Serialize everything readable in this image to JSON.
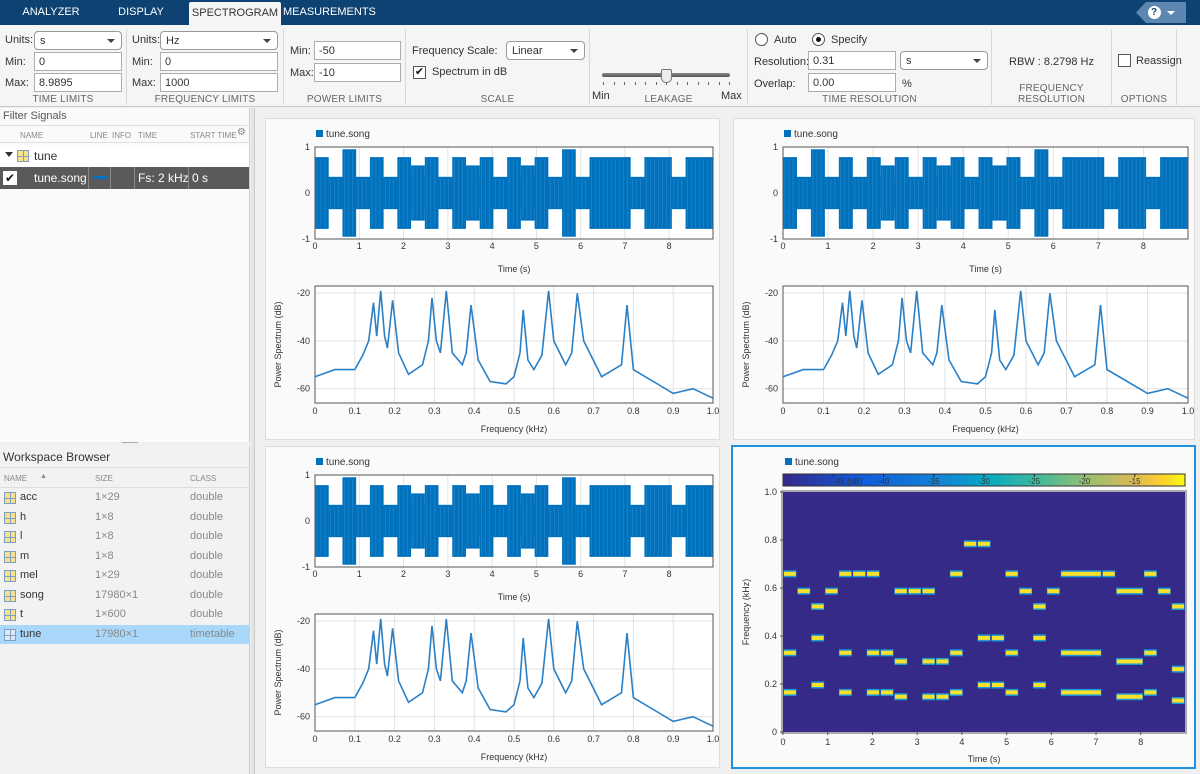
{
  "tabs": [
    {
      "label": "ANALYZER",
      "active": false
    },
    {
      "label": "DISPLAY",
      "active": false
    },
    {
      "label": "SPECTROGRAM",
      "active": true
    },
    {
      "label": "MEASUREMENTS",
      "active": false
    }
  ],
  "help": {
    "label": "?"
  },
  "ribbon": {
    "time_limits": {
      "title": "TIME LIMITS",
      "units_label": "Units:",
      "units_value": "s",
      "min_label": "Min:",
      "min_value": "0",
      "max_label": "Max:",
      "max_value": "8.9895"
    },
    "frequency_limits": {
      "title": "FREQUENCY LIMITS",
      "units_label": "Units:",
      "units_value": "Hz",
      "min_label": "Min:",
      "min_value": "0",
      "max_label": "Max:",
      "max_value": "1000"
    },
    "power_limits": {
      "title": "POWER LIMITS",
      "min_label": "Min:",
      "min_value": "-50",
      "max_label": "Max:",
      "max_value": "-10"
    },
    "scale": {
      "title": "SCALE",
      "freq_scale_label": "Frequency Scale:",
      "freq_scale_value": "Linear",
      "spectrum_db_label": "Spectrum in dB",
      "spectrum_db_checked": true
    },
    "leakage": {
      "title": "LEAKAGE",
      "min_label": "Min",
      "max_label": "Max",
      "value_fraction": 0.5
    },
    "time_resolution": {
      "title": "TIME RESOLUTION",
      "auto_label": "Auto",
      "specify_label": "Specify",
      "selected": "Specify",
      "resolution_label": "Resolution:",
      "resolution_value": "0.31",
      "resolution_units": "s",
      "overlap_label": "Overlap:",
      "overlap_value": "0.00",
      "overlap_units": "%"
    },
    "frequency_resolution": {
      "title": "FREQUENCY RESOLUTION",
      "rbw_text": "RBW : 8.2798 Hz"
    },
    "options": {
      "title": "OPTIONS",
      "reassign_label": "Reassign",
      "reassign_checked": false
    }
  },
  "filter_signals": {
    "title": "Filter Signals",
    "columns": [
      "NAME",
      "LINE",
      "INFO",
      "TIME",
      "START TIME"
    ],
    "group": {
      "name": "tune"
    },
    "rows": [
      {
        "name": "tune.song",
        "checked": true,
        "line_color": "#0072bd",
        "info": "",
        "time": "Fs: 2 kHz",
        "start_time": "0 s"
      }
    ]
  },
  "workspace": {
    "title": "Workspace Browser",
    "columns": [
      "NAME",
      "SIZE",
      "CLASS"
    ],
    "rows": [
      {
        "name": "acc",
        "size": "1×29",
        "class": "double",
        "selected": false
      },
      {
        "name": "h",
        "size": "1×8",
        "class": "double",
        "selected": false
      },
      {
        "name": "l",
        "size": "1×8",
        "class": "double",
        "selected": false
      },
      {
        "name": "m",
        "size": "1×8",
        "class": "double",
        "selected": false
      },
      {
        "name": "mel",
        "size": "1×29",
        "class": "double",
        "selected": false
      },
      {
        "name": "song",
        "size": "17980×1",
        "class": "double",
        "selected": false
      },
      {
        "name": "t",
        "size": "1×600",
        "class": "double",
        "selected": false
      },
      {
        "name": "tune",
        "size": "17980×1",
        "class": "timetable",
        "selected": true
      }
    ]
  },
  "colors": {
    "signal": "#0072bd",
    "selection": "#1e90e0",
    "tabbar": "#0e4272",
    "spec_bg": "#352a87",
    "spec_note": "#f9e02a"
  },
  "chart_data": [
    {
      "type": "line",
      "id": "time-domain",
      "legend": "tune.song",
      "xlabel": "Time (s)",
      "ylabel": "",
      "xlim": [
        0,
        8.9895
      ],
      "ylim": [
        -1,
        1
      ],
      "xticks": [
        0,
        1,
        2,
        3,
        4,
        5,
        6,
        7,
        8
      ],
      "yticks": [
        -1,
        0,
        1
      ],
      "segments": [
        {
          "t0": 0,
          "t1": 0.31,
          "amp": 0.78
        },
        {
          "t0": 0.31,
          "t1": 0.62,
          "amp": 0.35
        },
        {
          "t0": 0.62,
          "t1": 0.93,
          "amp": 0.95
        },
        {
          "t0": 0.93,
          "t1": 1.24,
          "amp": 0.35
        },
        {
          "t0": 1.24,
          "t1": 1.55,
          "amp": 0.78
        },
        {
          "t0": 1.55,
          "t1": 1.86,
          "amp": 0.35
        },
        {
          "t0": 1.86,
          "t1": 2.17,
          "amp": 0.78
        },
        {
          "t0": 2.17,
          "t1": 2.48,
          "amp": 0.6
        },
        {
          "t0": 2.48,
          "t1": 2.79,
          "amp": 0.78
        },
        {
          "t0": 2.79,
          "t1": 3.1,
          "amp": 0.35
        },
        {
          "t0": 3.1,
          "t1": 3.41,
          "amp": 0.78
        },
        {
          "t0": 3.41,
          "t1": 3.72,
          "amp": 0.6
        },
        {
          "t0": 3.72,
          "t1": 4.03,
          "amp": 0.78
        },
        {
          "t0": 4.03,
          "t1": 4.34,
          "amp": 0.35
        },
        {
          "t0": 4.34,
          "t1": 4.65,
          "amp": 0.78
        },
        {
          "t0": 4.65,
          "t1": 4.96,
          "amp": 0.6
        },
        {
          "t0": 4.96,
          "t1": 5.27,
          "amp": 0.78
        },
        {
          "t0": 5.27,
          "t1": 5.58,
          "amp": 0.35
        },
        {
          "t0": 5.58,
          "t1": 5.89,
          "amp": 0.95
        },
        {
          "t0": 5.89,
          "t1": 6.2,
          "amp": 0.35
        },
        {
          "t0": 6.2,
          "t1": 7.13,
          "amp": 0.78
        },
        {
          "t0": 7.13,
          "t1": 7.44,
          "amp": 0.35
        },
        {
          "t0": 7.44,
          "t1": 8.06,
          "amp": 0.78
        },
        {
          "t0": 8.06,
          "t1": 8.37,
          "amp": 0.35
        },
        {
          "t0": 8.37,
          "t1": 8.9895,
          "amp": 0.78
        }
      ]
    },
    {
      "type": "line",
      "id": "power-spectrum",
      "legend": "",
      "xlabel": "Frequency (kHz)",
      "ylabel": "Power Spectrum (dB)",
      "xlim": [
        0,
        1.0
      ],
      "ylim": [
        -66,
        -17
      ],
      "xticks": [
        0,
        0.1,
        0.2,
        0.3,
        0.4,
        0.5,
        0.6,
        0.7,
        0.8,
        0.9,
        1.0
      ],
      "yticks": [
        -60,
        -40,
        -20
      ],
      "x": [
        0,
        0.05,
        0.1,
        0.12,
        0.135,
        0.147,
        0.155,
        0.165,
        0.175,
        0.182,
        0.195,
        0.21,
        0.235,
        0.27,
        0.285,
        0.294,
        0.305,
        0.315,
        0.33,
        0.345,
        0.37,
        0.38,
        0.392,
        0.41,
        0.44,
        0.48,
        0.5,
        0.515,
        0.523,
        0.535,
        0.55,
        0.57,
        0.587,
        0.6,
        0.63,
        0.645,
        0.659,
        0.675,
        0.72,
        0.77,
        0.784,
        0.8,
        0.85,
        0.9,
        0.95,
        1.0
      ],
      "y": [
        -55,
        -52,
        -52,
        -46,
        -40,
        -24,
        -38,
        -19,
        -38,
        -43,
        -23,
        -45,
        -54,
        -50,
        -40,
        -22,
        -40,
        -45,
        -19,
        -45,
        -50,
        -45,
        -25,
        -48,
        -57,
        -58,
        -55,
        -45,
        -27,
        -48,
        -52,
        -46,
        -19,
        -40,
        -50,
        -45,
        -20,
        -40,
        -55,
        -50,
        -25,
        -52,
        -57,
        -62,
        -60,
        -64
      ]
    },
    {
      "type": "heatmap",
      "id": "spectrogram",
      "legend": "tune.song",
      "xlabel": "Time (s)",
      "ylabel": "Frequency (kHz)",
      "xlim": [
        0,
        8.9895
      ],
      "ylim": [
        0,
        1.0
      ],
      "xticks": [
        0,
        1,
        2,
        3,
        4,
        5,
        6,
        7,
        8
      ],
      "yticks": [
        0,
        0.2,
        0.4,
        0.6,
        0.8,
        1.0
      ],
      "colorbar": {
        "label": "(dB)",
        "ticks": [
          -45,
          -40,
          -35,
          -30,
          -25,
          -20,
          -15
        ],
        "range": [
          -50,
          -10
        ]
      },
      "notes": [
        {
          "t0": 0,
          "t1": 0.31,
          "f": [
            0.165,
            0.33,
            0.659
          ]
        },
        {
          "t0": 0.31,
          "t1": 0.62,
          "f": [
            0.587
          ]
        },
        {
          "t0": 0.62,
          "t1": 0.93,
          "f": [
            0.196,
            0.392,
            0.523
          ]
        },
        {
          "t0": 0.93,
          "t1": 1.24,
          "f": [
            0.587
          ]
        },
        {
          "t0": 1.24,
          "t1": 1.55,
          "f": [
            0.165,
            0.33,
            0.659
          ]
        },
        {
          "t0": 1.55,
          "t1": 1.86,
          "f": [
            0.659
          ]
        },
        {
          "t0": 1.86,
          "t1": 2.17,
          "f": [
            0.165,
            0.33,
            0.659
          ]
        },
        {
          "t0": 2.17,
          "t1": 2.48,
          "f": [
            0.165,
            0.33
          ]
        },
        {
          "t0": 2.48,
          "t1": 2.79,
          "f": [
            0.147,
            0.294,
            0.587
          ]
        },
        {
          "t0": 2.79,
          "t1": 3.1,
          "f": [
            0.587
          ]
        },
        {
          "t0": 3.1,
          "t1": 3.41,
          "f": [
            0.147,
            0.294,
            0.587
          ]
        },
        {
          "t0": 3.41,
          "t1": 3.72,
          "f": [
            0.147,
            0.294
          ]
        },
        {
          "t0": 3.72,
          "t1": 4.03,
          "f": [
            0.165,
            0.33,
            0.659
          ]
        },
        {
          "t0": 4.03,
          "t1": 4.34,
          "f": [
            0.784
          ]
        },
        {
          "t0": 4.34,
          "t1": 4.65,
          "f": [
            0.196,
            0.392,
            0.784
          ]
        },
        {
          "t0": 4.65,
          "t1": 4.96,
          "f": [
            0.196,
            0.392
          ]
        },
        {
          "t0": 4.96,
          "t1": 5.27,
          "f": [
            0.165,
            0.33,
            0.659
          ]
        },
        {
          "t0": 5.27,
          "t1": 5.58,
          "f": [
            0.587
          ]
        },
        {
          "t0": 5.58,
          "t1": 5.89,
          "f": [
            0.196,
            0.392,
            0.523
          ]
        },
        {
          "t0": 5.89,
          "t1": 6.2,
          "f": [
            0.587
          ]
        },
        {
          "t0": 6.2,
          "t1": 7.13,
          "f": [
            0.165,
            0.33,
            0.659
          ]
        },
        {
          "t0": 7.13,
          "t1": 7.44,
          "f": [
            0.659
          ]
        },
        {
          "t0": 7.44,
          "t1": 8.06,
          "f": [
            0.147,
            0.294,
            0.587
          ]
        },
        {
          "t0": 8.06,
          "t1": 8.37,
          "f": [
            0.165,
            0.33,
            0.659
          ]
        },
        {
          "t0": 8.37,
          "t1": 8.68,
          "f": [
            0.587
          ]
        },
        {
          "t0": 8.68,
          "t1": 8.9895,
          "f": [
            0.131,
            0.262,
            0.523
          ]
        }
      ]
    }
  ]
}
